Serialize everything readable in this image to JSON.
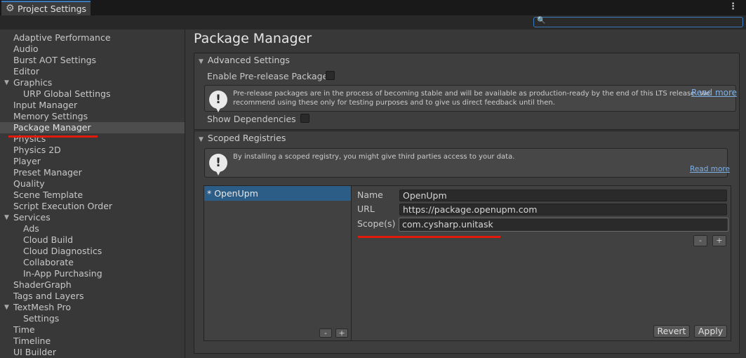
{
  "window": {
    "tab_title": "Project Settings"
  },
  "search": {
    "placeholder": ""
  },
  "sidebar": {
    "items": [
      {
        "label": "Adaptive Performance"
      },
      {
        "label": "Audio"
      },
      {
        "label": "Burst AOT Settings"
      },
      {
        "label": "Editor"
      },
      {
        "label": "Graphics"
      },
      {
        "label": "URP Global Settings"
      },
      {
        "label": "Input Manager"
      },
      {
        "label": "Memory Settings"
      },
      {
        "label": "Package Manager"
      },
      {
        "label": "Physics"
      },
      {
        "label": "Physics 2D"
      },
      {
        "label": "Player"
      },
      {
        "label": "Preset Manager"
      },
      {
        "label": "Quality"
      },
      {
        "label": "Scene Template"
      },
      {
        "label": "Script Execution Order"
      },
      {
        "label": "Services"
      },
      {
        "label": "Ads"
      },
      {
        "label": "Cloud Build"
      },
      {
        "label": "Cloud Diagnostics"
      },
      {
        "label": "Collaborate"
      },
      {
        "label": "In-App Purchasing"
      },
      {
        "label": "ShaderGraph"
      },
      {
        "label": "Tags and Layers"
      },
      {
        "label": "TextMesh Pro"
      },
      {
        "label": "Settings"
      },
      {
        "label": "Time"
      },
      {
        "label": "Timeline"
      },
      {
        "label": "UI Builder"
      }
    ],
    "selected": "Package Manager"
  },
  "main": {
    "title": "Package Manager",
    "advanced": {
      "header": "Advanced Settings",
      "prerelease_label": "Enable Pre-release Packages",
      "prerelease_checked": false,
      "help_line1": "Pre-release packages are in the process of becoming stable and will be available as production-ready by the end of this LTS release. We",
      "help_line2": "recommend using these only for testing purposes and to give us direct feedback until then.",
      "read_more": "Read more",
      "show_deps_label": "Show Dependencies",
      "show_deps_checked": false
    },
    "scoped": {
      "header": "Scoped Registries",
      "help_text": "By installing a scoped registry, you might give third parties access to your data.",
      "read_more": "Read more",
      "registries": [
        {
          "label": "* OpenUpm"
        }
      ],
      "minus": "-",
      "plus": "+",
      "name_label": "Name",
      "name_value": "OpenUpm",
      "url_label": "URL",
      "url_value": "https://package.openupm.com",
      "scope_label": "Scope(s)",
      "scope_value": "com.cysharp.unitask",
      "revert": "Revert",
      "apply": "Apply"
    }
  },
  "colors": {
    "accent": "#3a79bb",
    "selection": "#2c5d87",
    "annotation_red": "#e21a0c",
    "link": "#7fb0e8"
  }
}
